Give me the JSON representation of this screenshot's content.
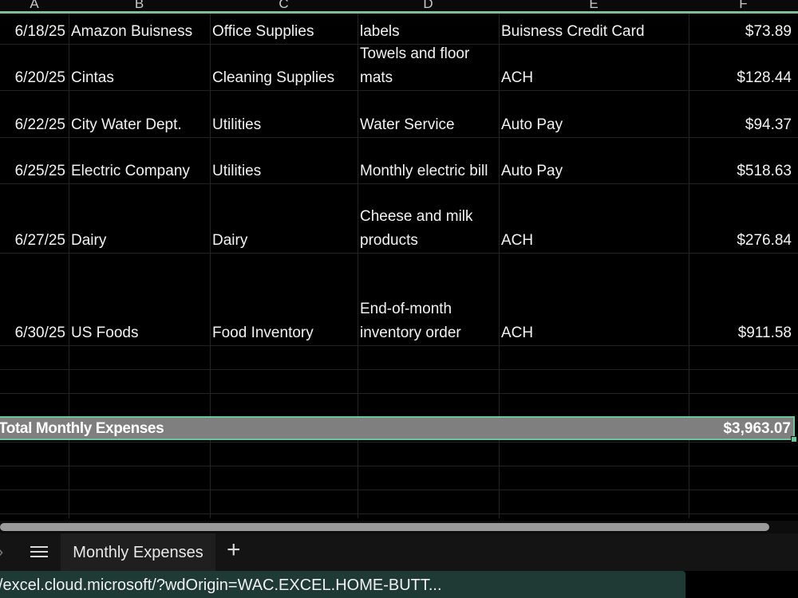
{
  "columns": [
    "A",
    "B",
    "C",
    "D",
    "E",
    "F"
  ],
  "rows": [
    {
      "date": "6/18/25",
      "vendor": "Amazon Buisness",
      "category": "Office Supplies",
      "description": "labels",
      "payment": "Buisness Credit Card",
      "amount": "$73.89"
    },
    {
      "date": "6/20/25",
      "vendor": "Cintas",
      "category": "Cleaning Supplies",
      "description": "Towels and floor mats",
      "payment": "ACH",
      "amount": "$128.44"
    },
    {
      "date": "6/22/25",
      "vendor": "City Water Dept.",
      "category": "Utilities",
      "description": "Water Service",
      "payment": "Auto Pay",
      "amount": "$94.37"
    },
    {
      "date": "6/25/25",
      "vendor": "Electric Company",
      "category": "Utilities",
      "description": "Monthly electric bill",
      "payment": "Auto Pay",
      "amount": "$518.63"
    },
    {
      "date": "6/27/25",
      "vendor": "Dairy",
      "category": "Dairy",
      "description": "Cheese and milk products",
      "payment": "ACH",
      "amount": "$276.84"
    },
    {
      "date": "6/30/25",
      "vendor": "US Foods",
      "category": "Food Inventory",
      "description": "End-of-month inventory order",
      "payment": "ACH",
      "amount": "$911.58"
    }
  ],
  "total": {
    "label": "Total Monthly Expenses",
    "value": "$3,963.07"
  },
  "sheet_tab": "Monthly Expenses",
  "add_sheet_label": "+",
  "status_url": "/excel.cloud.microsoft/?wdOrigin=WAC.EXCEL.HOME-BUTT...",
  "icons": {
    "nav": "chevron-right-icon",
    "menu": "hamburger-menu-icon",
    "add": "plus-icon"
  },
  "colors": {
    "accent": "#6cc49a",
    "total_fill": "#7f7f7f",
    "status_bg": "#1f3a35"
  }
}
